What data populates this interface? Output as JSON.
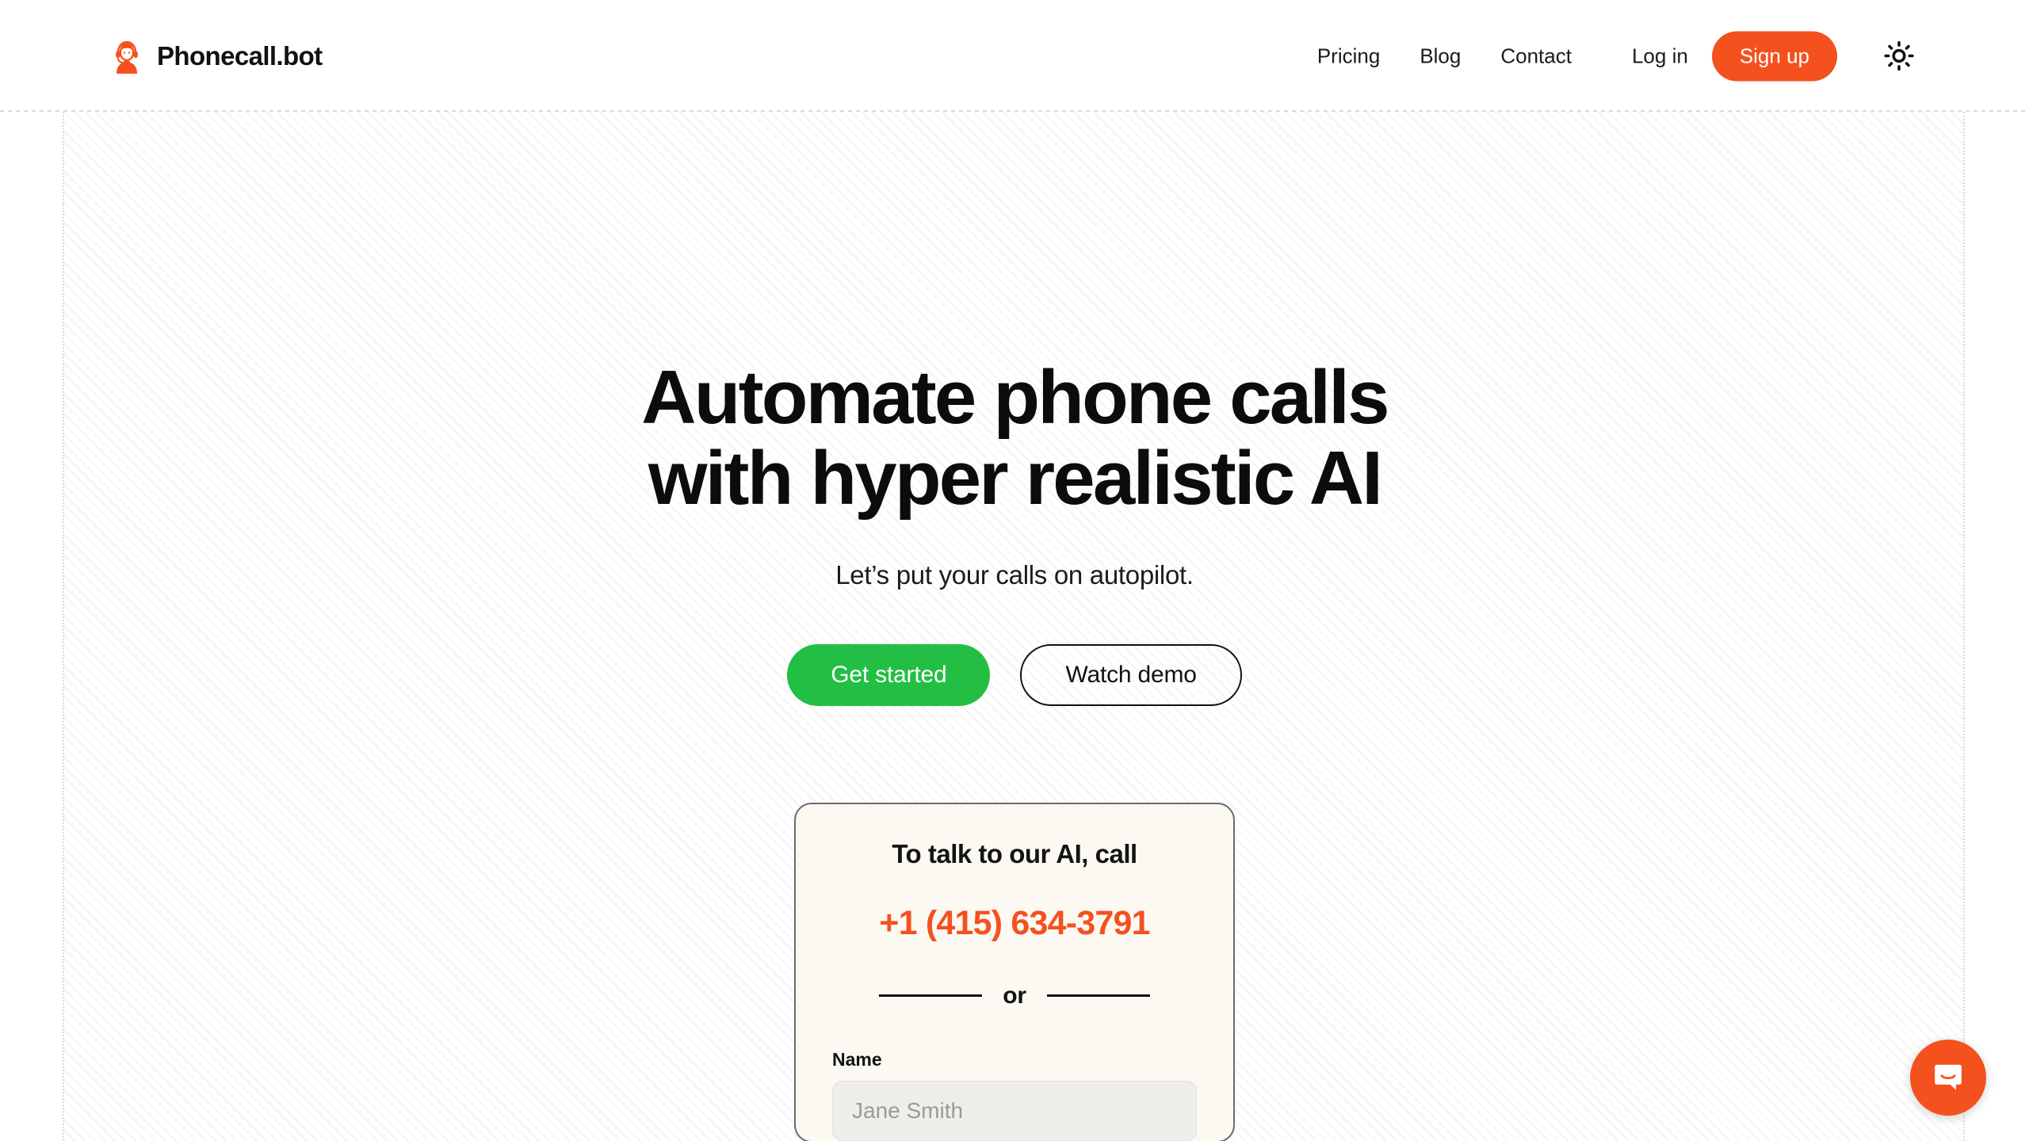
{
  "brand": {
    "name": "Phonecall.bot",
    "logo_icon": "headset-avatar-icon",
    "accent_color": "#F4511E"
  },
  "header": {
    "nav_links": [
      {
        "label": "Pricing"
      },
      {
        "label": "Blog"
      },
      {
        "label": "Contact"
      }
    ],
    "login_label": "Log in",
    "signup_label": "Sign up",
    "theme_toggle_icon": "sun-icon",
    "theme_toggle_title": "Switch to dark mode"
  },
  "hero": {
    "headline_line_1": "Automate phone calls",
    "headline_line_2": "with hyper realistic AI",
    "subhead": "Let’s put your calls on autopilot.",
    "primary_cta": "Get started",
    "secondary_cta": "Watch demo",
    "primary_cta_color": "#22BF44"
  },
  "call_card": {
    "title": "To talk to our AI, call",
    "phone_number": "+1 (415) 634-3791",
    "phone_color": "#F4511E",
    "divider_label": "or",
    "name_field": {
      "label": "Name",
      "value": "",
      "placeholder": "Jane Smith"
    }
  },
  "chat": {
    "launcher_icon": "chat-bubble-icon",
    "launcher_title": "Open chat",
    "launcher_color": "#F4511E"
  }
}
